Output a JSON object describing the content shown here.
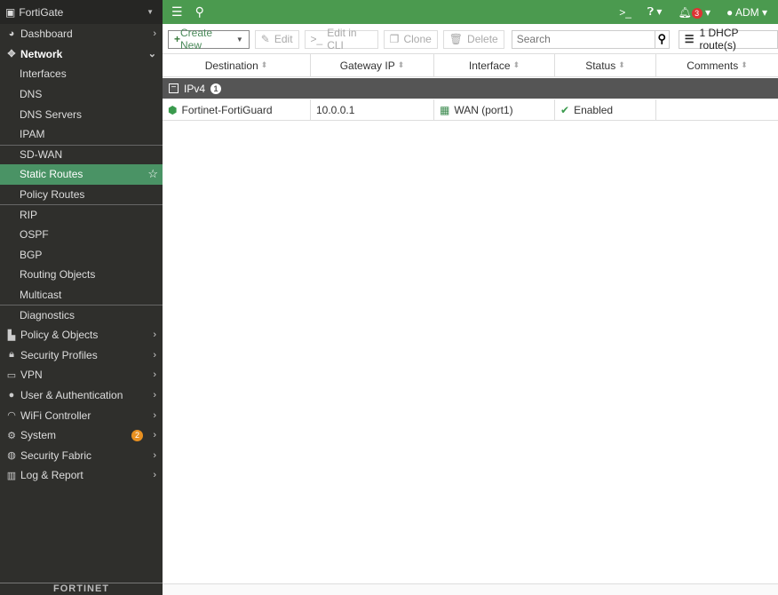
{
  "brand": "FortiGate",
  "sidebar": {
    "items": [
      {
        "label": "Dashboard",
        "icon": "dashboard-icon"
      },
      {
        "label": "Network",
        "icon": "network-icon"
      },
      {
        "label": "Interfaces"
      },
      {
        "label": "DNS"
      },
      {
        "label": "DNS Servers"
      },
      {
        "label": "IPAM"
      },
      {
        "label": "SD-WAN"
      },
      {
        "label": "Static Routes"
      },
      {
        "label": "Policy Routes"
      },
      {
        "label": "RIP"
      },
      {
        "label": "OSPF"
      },
      {
        "label": "BGP"
      },
      {
        "label": "Routing Objects"
      },
      {
        "label": "Multicast"
      },
      {
        "label": "Diagnostics"
      },
      {
        "label": "Policy & Objects"
      },
      {
        "label": "Security Profiles"
      },
      {
        "label": "VPN"
      },
      {
        "label": "User & Authentication"
      },
      {
        "label": "WiFi Controller"
      },
      {
        "label": "System",
        "badge": "2"
      },
      {
        "label": "Security Fabric"
      },
      {
        "label": "Log & Report"
      }
    ],
    "footer_logo": "FORTINET"
  },
  "topbar": {
    "notifications": "3",
    "user": "ADM"
  },
  "toolbar": {
    "create": "Create New",
    "edit": "Edit",
    "edit_cli": "Edit in CLI",
    "clone": "Clone",
    "delete": "Delete",
    "search_placeholder": "Search",
    "dhcp": "1 DHCP route(s)"
  },
  "table": {
    "columns": [
      "Destination",
      "Gateway IP",
      "Interface",
      "Status",
      "Comments"
    ],
    "group": {
      "label": "IPv4",
      "count": "1"
    },
    "rows": [
      {
        "destination": "Fortinet-FortiGuard",
        "gateway": "10.0.0.1",
        "interface": "WAN (port1)",
        "status": "Enabled",
        "comments": ""
      }
    ]
  },
  "colors": {
    "accent": "#4b9a4f",
    "active": "#4a9365",
    "sidebar": "#2f2f2c"
  }
}
